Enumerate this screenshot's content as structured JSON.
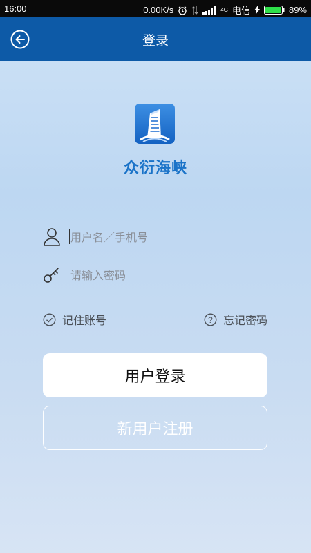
{
  "status_bar": {
    "time": "16:00",
    "network_speed": "0.00K/s",
    "network_type": "4G",
    "carrier": "电信",
    "battery": "89%"
  },
  "header": {
    "title": "登录",
    "back_icon": "back-arrow-icon"
  },
  "logo": {
    "text": "众衍海峡",
    "icon": "building-icon"
  },
  "form": {
    "username_placeholder": "用户名／手机号",
    "username_value": "",
    "password_placeholder": "请输入密码",
    "password_value": "",
    "remember_label": "记住账号",
    "forgot_label": "忘记密码"
  },
  "buttons": {
    "login_label": "用户登录",
    "register_label": "新用户注册"
  },
  "colors": {
    "header_bg": "#0d5aa7",
    "accent": "#1a73c8",
    "background": "#c6dcf3"
  }
}
